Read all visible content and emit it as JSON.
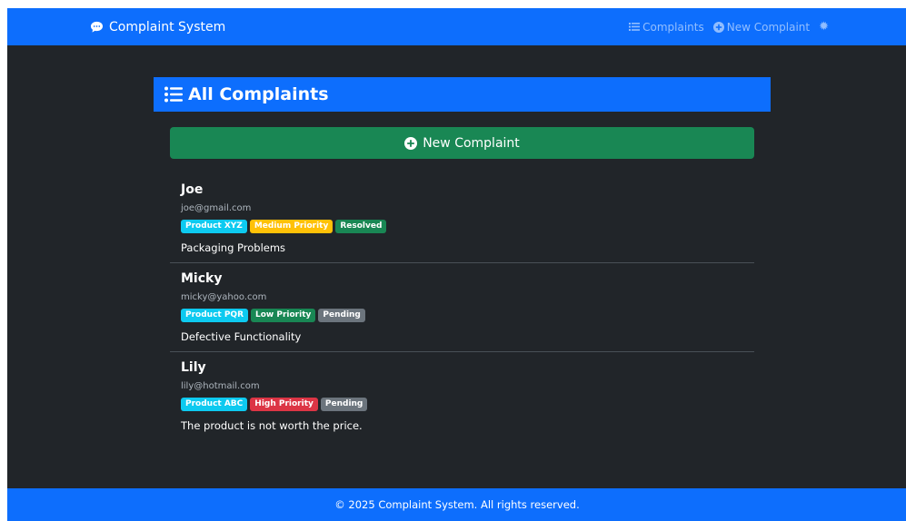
{
  "navbar": {
    "brand": "Complaint System",
    "links": [
      {
        "label": "Complaints",
        "icon": "list-icon"
      },
      {
        "label": "New Complaint",
        "icon": "plus-circle-icon"
      }
    ],
    "settings_icon": "gear-icon"
  },
  "header": {
    "title": "All Complaints",
    "icon": "list-icon"
  },
  "new_button": {
    "label": "New Complaint",
    "icon": "plus-circle-icon"
  },
  "complaints": [
    {
      "name": "Joe",
      "email": "joe@gmail.com",
      "badges": [
        {
          "text": "Product XYZ",
          "color": "#0dcaf0"
        },
        {
          "text": "Medium Priority",
          "color": "#ffc107"
        },
        {
          "text": "Resolved",
          "color": "#198754"
        }
      ],
      "description": "Packaging Problems"
    },
    {
      "name": "Micky",
      "email": "micky@yahoo.com",
      "badges": [
        {
          "text": "Product PQR",
          "color": "#0dcaf0"
        },
        {
          "text": "Low Priority",
          "color": "#198754"
        },
        {
          "text": "Pending",
          "color": "#6c757d"
        }
      ],
      "description": "Defective Functionality"
    },
    {
      "name": "Lily",
      "email": "lily@hotmail.com",
      "badges": [
        {
          "text": "Product ABC",
          "color": "#0dcaf0"
        },
        {
          "text": "High Priority",
          "color": "#dc3545"
        },
        {
          "text": "Pending",
          "color": "#6c757d"
        }
      ],
      "description": "The product is not worth the price."
    }
  ],
  "footer": {
    "text": "© 2025 Complaint System. All rights reserved."
  },
  "colors": {
    "primary": "#0d6efd",
    "success": "#198754",
    "dark_bg": "#212529"
  }
}
